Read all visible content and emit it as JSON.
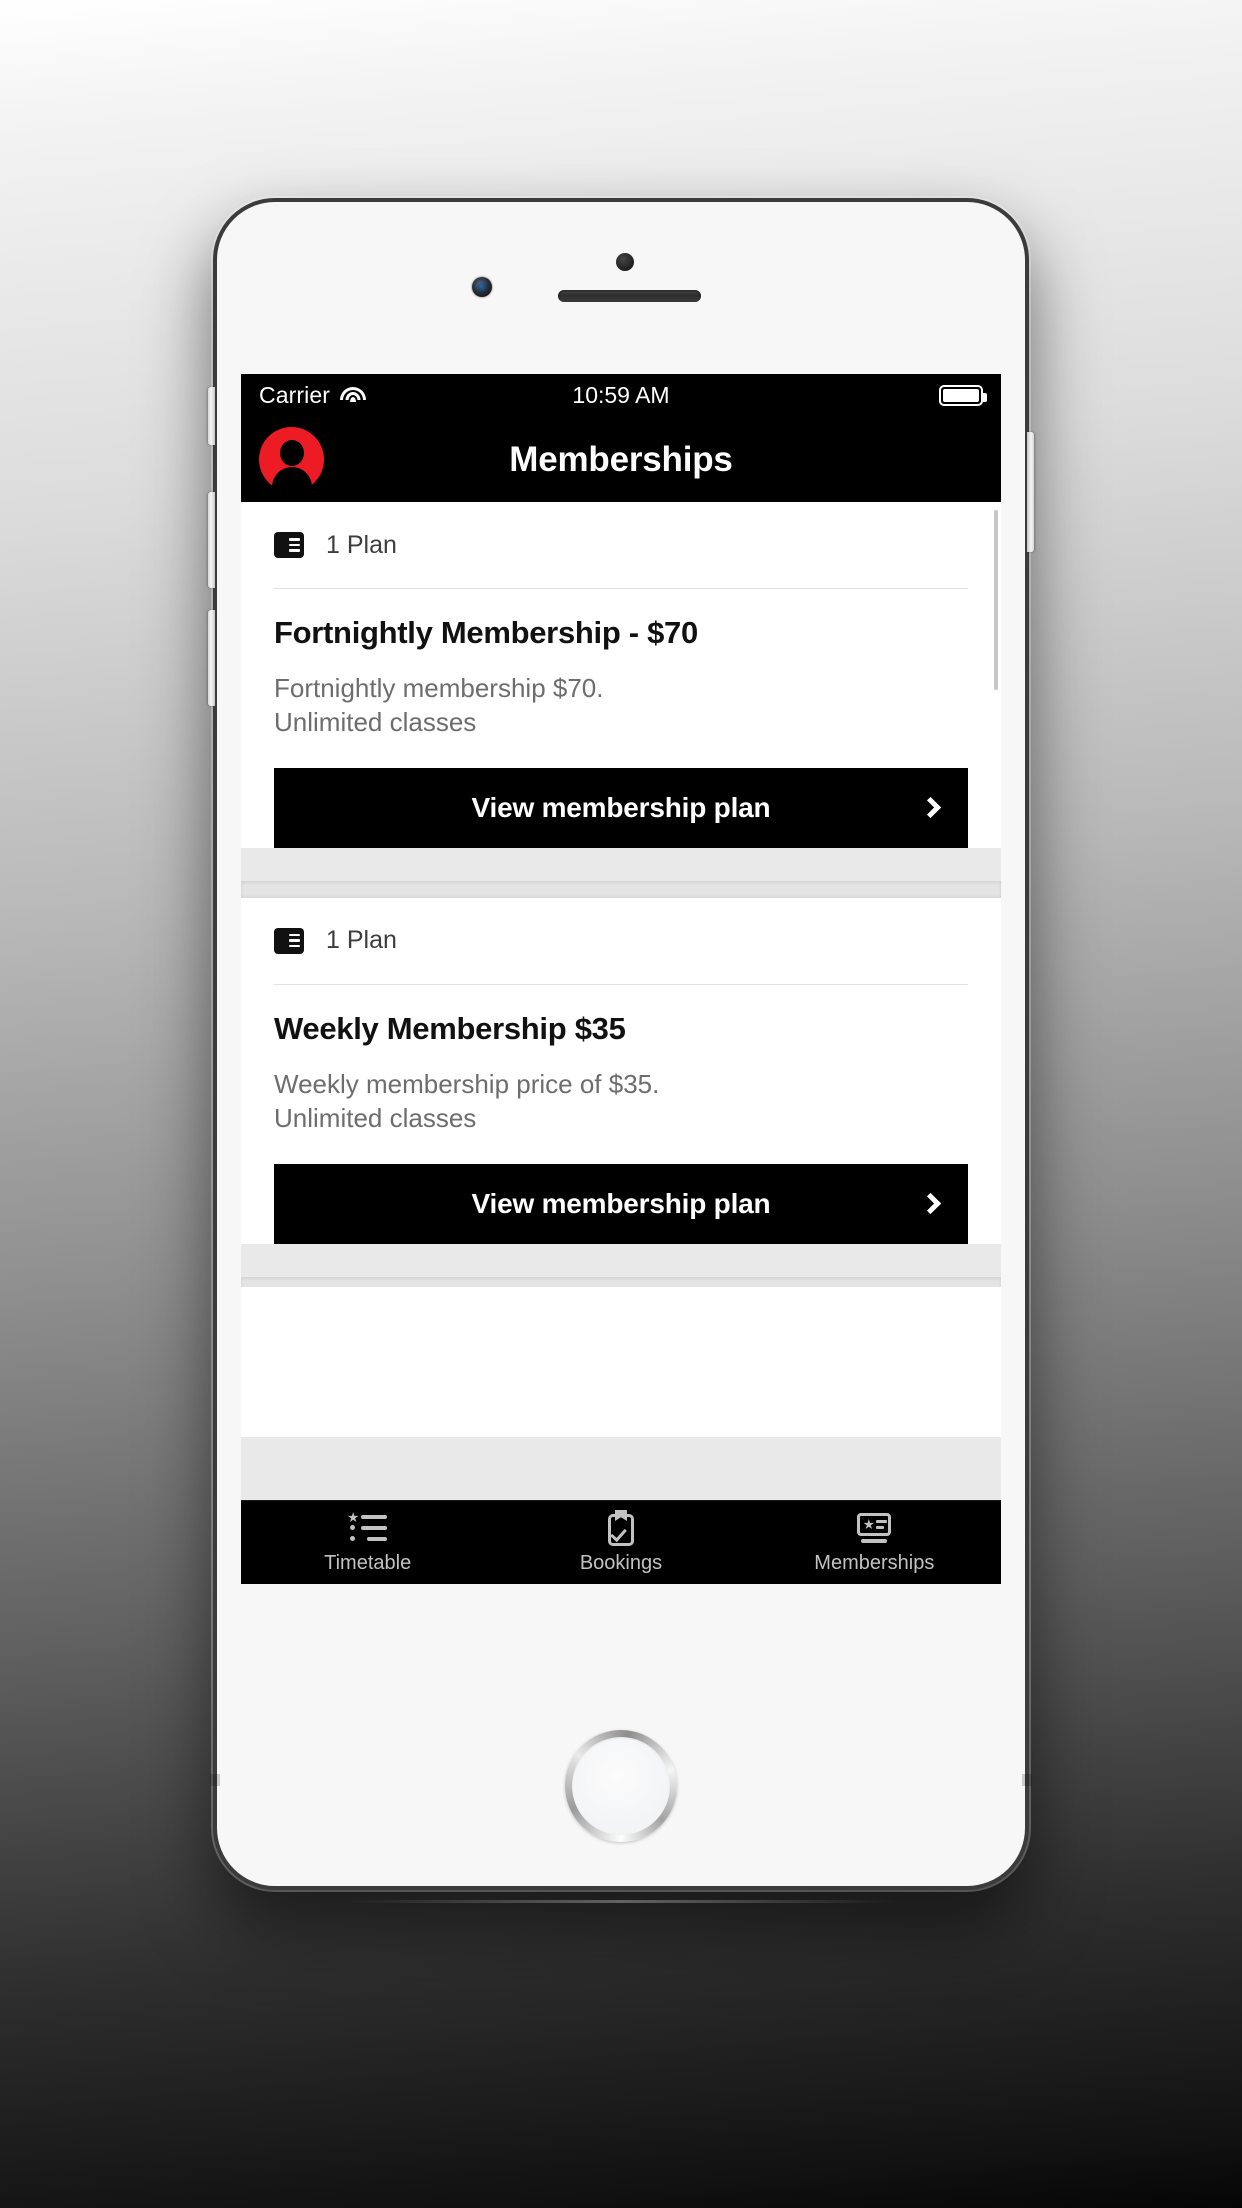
{
  "status_bar": {
    "carrier": "Carrier",
    "wifi_icon": "wifi-icon",
    "time": "10:59 AM",
    "battery_icon": "battery-full-icon"
  },
  "nav": {
    "title": "Memberships",
    "avatar_icon": "user-avatar-icon",
    "avatar_color": "#ed1c24",
    "background": "#000000"
  },
  "cards": [
    {
      "plan_icon": "membership-card-icon",
      "plan_count": "1 Plan",
      "title": "Fortnightly Membership - $70",
      "description_line_1": "Fortnightly membership $70.",
      "description_line_2": "Unlimited classes",
      "button_label": "View membership plan",
      "button_chevron": "chevron-right-icon"
    },
    {
      "plan_icon": "membership-card-icon",
      "plan_count": "1 Plan",
      "title": "Weekly Membership $35",
      "description_line_1": "Weekly membership price of $35.",
      "description_line_2": "Unlimited classes",
      "button_label": "View membership plan",
      "button_chevron": "chevron-right-icon"
    }
  ],
  "tabs": [
    {
      "label": "Timetable",
      "icon": "timetable-list-icon"
    },
    {
      "label": "Bookings",
      "icon": "clipboard-check-icon"
    },
    {
      "label": "Memberships",
      "icon": "membership-card-icon"
    }
  ],
  "colors": {
    "accent_red": "#ed1c24",
    "bar_black": "#000000",
    "body_text": "#6d6d6d",
    "title_text": "#111111",
    "tab_label": "#c2c2c2"
  }
}
